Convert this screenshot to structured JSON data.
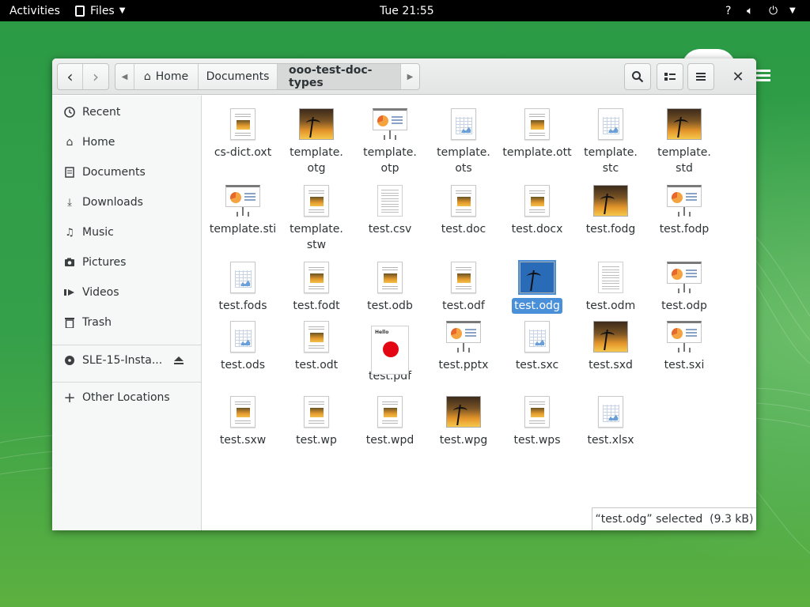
{
  "topbar": {
    "activities": "Activities",
    "app_menu": "Files",
    "clock": "Tue 21:55"
  },
  "header": {
    "back_icon": "go-previous-icon",
    "forward_icon": "go-next-icon",
    "breadcrumbs": [
      "Home",
      "Documents",
      "ooo-test-doc-types"
    ],
    "search_icon": "search-icon",
    "view_icon": "view-list-icon",
    "menu_icon": "hamburger-menu-icon",
    "close_icon": "close-icon"
  },
  "sidebar": {
    "items": [
      {
        "label": "Recent",
        "icon": "recent-icon"
      },
      {
        "label": "Home",
        "icon": "home-icon"
      },
      {
        "label": "Documents",
        "icon": "documents-icon"
      },
      {
        "label": "Downloads",
        "icon": "downloads-icon"
      },
      {
        "label": "Music",
        "icon": "music-icon"
      },
      {
        "label": "Pictures",
        "icon": "pictures-icon"
      },
      {
        "label": "Videos",
        "icon": "videos-icon"
      },
      {
        "label": "Trash",
        "icon": "trash-icon"
      }
    ],
    "device": {
      "label": "SLE-15-Insta...",
      "icon": "disc-icon",
      "eject_icon": "eject-icon"
    },
    "other": {
      "label": "Other Locations",
      "icon": "plus-icon"
    }
  },
  "files": [
    {
      "name": "cs-dict.oxt",
      "kind": "doc"
    },
    {
      "name": "template.\notg",
      "kind": "img"
    },
    {
      "name": "template.\notp",
      "kind": "pres"
    },
    {
      "name": "template.\nots",
      "kind": "sheet"
    },
    {
      "name": "template.ott",
      "kind": "doc"
    },
    {
      "name": "template.\nstc",
      "kind": "sheet"
    },
    {
      "name": "template.\nstd",
      "kind": "img"
    },
    {
      "name": "template.sti",
      "kind": "pres"
    },
    {
      "name": "template.\nstw",
      "kind": "doc"
    },
    {
      "name": "test.csv",
      "kind": "txt"
    },
    {
      "name": "test.doc",
      "kind": "doc"
    },
    {
      "name": "test.docx",
      "kind": "doc"
    },
    {
      "name": "test.fodg",
      "kind": "img"
    },
    {
      "name": "test.fodp",
      "kind": "pres"
    },
    {
      "name": "test.fods",
      "kind": "sheet"
    },
    {
      "name": "test.fodt",
      "kind": "doc"
    },
    {
      "name": "test.odb",
      "kind": "doc"
    },
    {
      "name": "test.odf",
      "kind": "doc"
    },
    {
      "name": "test.odg",
      "kind": "img",
      "selected": true
    },
    {
      "name": "test.odm",
      "kind": "txt"
    },
    {
      "name": "test.odp",
      "kind": "pres"
    },
    {
      "name": "test.ods",
      "kind": "sheet"
    },
    {
      "name": "test.odt",
      "kind": "doc"
    },
    {
      "name": "test.pdf",
      "kind": "pdf",
      "pdf_text": "Hello"
    },
    {
      "name": "test.pptx",
      "kind": "pres"
    },
    {
      "name": "test.sxc",
      "kind": "sheet"
    },
    {
      "name": "test.sxd",
      "kind": "img"
    },
    {
      "name": "test.sxi",
      "kind": "pres"
    },
    {
      "name": "test.sxw",
      "kind": "doc"
    },
    {
      "name": "test.wp",
      "kind": "doc"
    },
    {
      "name": "test.wpd",
      "kind": "doc"
    },
    {
      "name": "test.wpg",
      "kind": "img"
    },
    {
      "name": "test.wps",
      "kind": "doc"
    },
    {
      "name": "test.xlsx",
      "kind": "sheet"
    }
  ],
  "status": {
    "text": "“test.odg” selected  (9.3 kB)"
  },
  "colors": {
    "selection": "#4a90d9",
    "topbar": "#000000",
    "desktop": "#35a04a"
  }
}
